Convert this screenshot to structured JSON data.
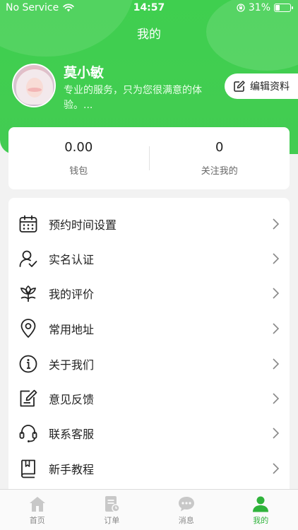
{
  "status_bar": {
    "carrier": "No Service",
    "time": "14:57",
    "battery": "31%",
    "battery_level": 0.31
  },
  "page": {
    "title": "我的"
  },
  "profile": {
    "name": "莫小敏",
    "bio": "专业的服务，只为您很满意的体验。...",
    "edit_label": "编辑资料"
  },
  "stats": [
    {
      "value": "0.00",
      "label": "钱包"
    },
    {
      "value": "0",
      "label": "关注我的"
    }
  ],
  "menu": [
    {
      "label": "预约时间设置",
      "icon": "calendar-icon"
    },
    {
      "label": "实名认证",
      "icon": "user-check-icon"
    },
    {
      "label": "我的评价",
      "icon": "flower-icon"
    },
    {
      "label": "常用地址",
      "icon": "location-pin-icon"
    },
    {
      "label": "关于我们",
      "icon": "info-icon"
    },
    {
      "label": "意见反馈",
      "icon": "feedback-icon"
    },
    {
      "label": "联系客服",
      "icon": "headset-icon"
    },
    {
      "label": "新手教程",
      "icon": "book-icon"
    }
  ],
  "tabbar": [
    {
      "label": "首页",
      "icon": "home-icon"
    },
    {
      "label": "订单",
      "icon": "order-icon"
    },
    {
      "label": "消息",
      "icon": "message-icon"
    },
    {
      "label": "我的",
      "icon": "profile-icon"
    }
  ],
  "colors": {
    "accent": "#3fcf4f",
    "active_tab": "#2fb33b",
    "inactive_tab": "#c8c8c8"
  }
}
